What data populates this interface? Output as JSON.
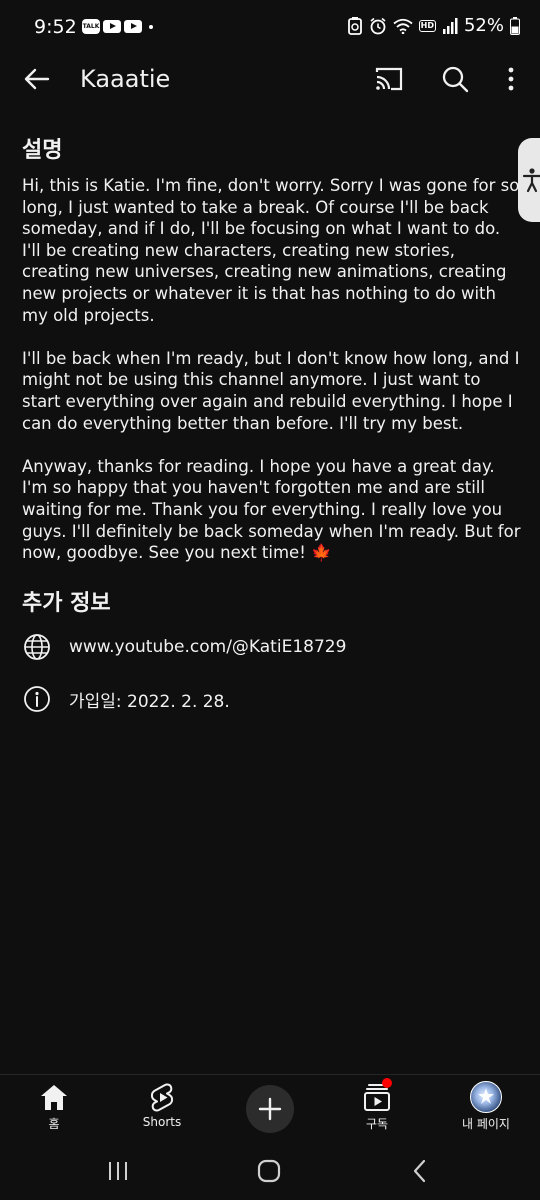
{
  "status_bar": {
    "time": "9:52",
    "talk_badge": "TALK",
    "battery": "52%",
    "hd": "HD"
  },
  "app_bar": {
    "title": "Kaaatie"
  },
  "description_section": {
    "heading": "설명",
    "paragraphs": [
      "Hi, this is Katie. I'm fine, don't worry. Sorry I was gone for so long, I just wanted to take a break. Of course I'll be back someday, and if I do, I'll be focusing on what I want to do. I'll be creating new characters, creating new stories, creating new universes, creating new animations, creating new projects or whatever it is that has nothing to do with my old projects.",
      "I'll be back when I'm ready, but I don't know how long, and I might not be using this channel anymore. I just want to start everything over again and rebuild everything. I hope I can do everything better than before. I'll try my best.",
      "Anyway, thanks for reading. I hope you have a great day. I'm so happy that you haven't forgotten me and are still waiting for me. Thank you for everything. I really love you guys. I'll definitely be back someday when I'm ready. But for now, goodbye. See you next time! 🍁"
    ]
  },
  "more_info_section": {
    "heading": "추가 정보",
    "link": "www.youtube.com/@KatiE18729",
    "joined": "가입일: 2022. 2. 28."
  },
  "bottom_nav": {
    "home": "홈",
    "shorts": "Shorts",
    "subscriptions": "구독",
    "you": "내 페이지"
  },
  "colors": {
    "background": "#0f0f0f",
    "text": "#f1f1f1",
    "notification": "#ff0000"
  }
}
